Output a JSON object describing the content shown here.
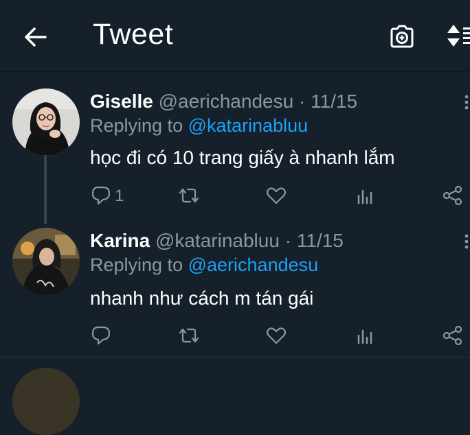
{
  "header": {
    "title": "Tweet"
  },
  "tweets": [
    {
      "name": "Giselle",
      "handle": "@aerichandesu",
      "separator": "·",
      "date": "11/15",
      "replying_prefix": "Replying to",
      "replying_to": "@katarinabluu",
      "text": "học đi có 10 trang giấy à nhanh lắm",
      "reply_count": "1"
    },
    {
      "name": "Karina",
      "handle": "@katarinabluu",
      "separator": "·",
      "date": "11/15",
      "replying_prefix": "Replying to",
      "replying_to": "@aerichandesu",
      "text": "nhanh như cách m tán gái",
      "reply_count": ""
    }
  ],
  "icons": {
    "back": "arrow-left-icon",
    "camera": "camera-icon",
    "sort": "sort-icon",
    "reply": "reply-icon",
    "retweet": "retweet-icon",
    "like": "heart-icon",
    "analytics": "analytics-icon",
    "share": "share-icon",
    "more": "more-icon"
  },
  "colors": {
    "background": "#15202b",
    "secondary_text": "#8899a6",
    "link": "#1da1f2",
    "divider": "#38444d"
  }
}
